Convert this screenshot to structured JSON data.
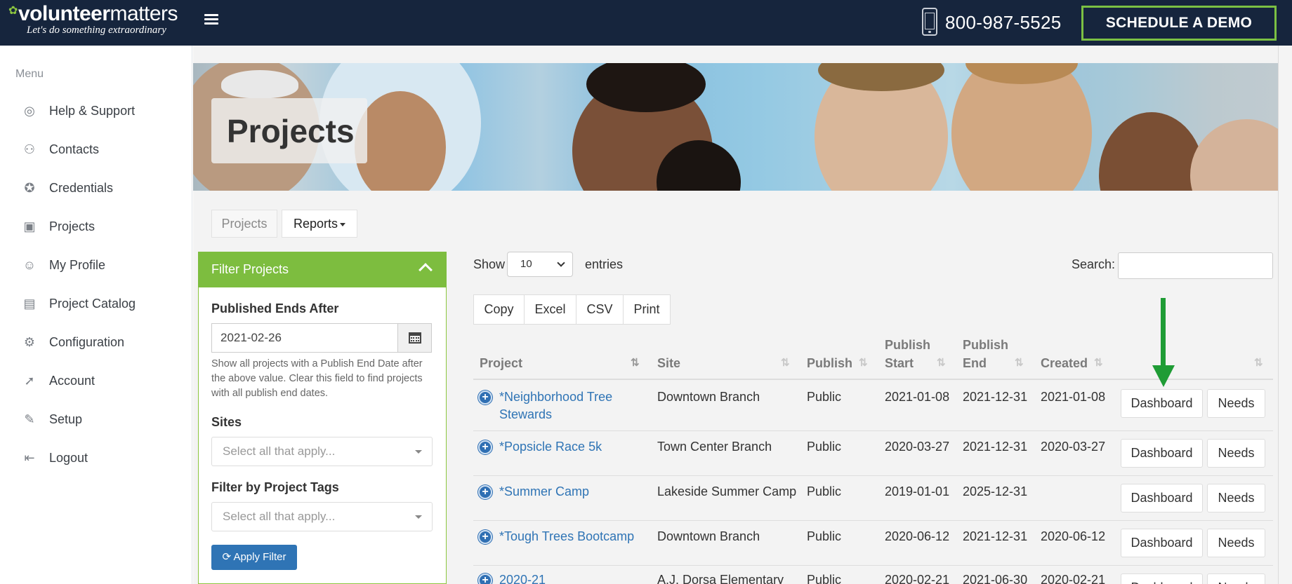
{
  "header": {
    "logo_bold": "volunteer",
    "logo_light": "matters",
    "tagline": "Let's do something extraordinary",
    "phone": "800-987-5525",
    "demo_button": "SCHEDULE A DEMO"
  },
  "sidebar": {
    "title": "Menu",
    "items": [
      {
        "label": "Help & Support",
        "icon": "help-icon"
      },
      {
        "label": "Contacts",
        "icon": "contacts-icon"
      },
      {
        "label": "Credentials",
        "icon": "credentials-icon"
      },
      {
        "label": "Projects",
        "icon": "projects-icon"
      },
      {
        "label": "My Profile",
        "icon": "profile-icon"
      },
      {
        "label": "Project Catalog",
        "icon": "catalog-icon"
      },
      {
        "label": "Configuration",
        "icon": "gear-icon"
      },
      {
        "label": "Account",
        "icon": "rocket-icon"
      },
      {
        "label": "Setup",
        "icon": "wrench-icon"
      },
      {
        "label": "Logout",
        "icon": "logout-icon"
      }
    ]
  },
  "banner": {
    "title": "Projects"
  },
  "tabs": {
    "projects": "Projects",
    "reports": "Reports"
  },
  "filter": {
    "header": "Filter Projects",
    "published_label": "Published Ends After",
    "published_value": "2021-02-26",
    "help_text": "Show all projects with a Publish End Date after the above value. Clear this field to find projects with all publish end dates.",
    "sites_label": "Sites",
    "sites_placeholder": "Select all that apply...",
    "tags_label": "Filter by Project Tags",
    "tags_placeholder": "Select all that apply...",
    "apply_button": "Apply Filter"
  },
  "table_controls": {
    "show": "Show",
    "page_size": "10",
    "entries": "entries",
    "search": "Search:",
    "export_buttons": [
      "Copy",
      "Excel",
      "CSV",
      "Print"
    ]
  },
  "table": {
    "headers": {
      "project": "Project",
      "site": "Site",
      "publish": "Publish",
      "publish_start_1": "Publish",
      "publish_start_2": "Start",
      "publish_end_1": "Publish",
      "publish_end_2": "End",
      "created": "Created"
    },
    "dashboard_label": "Dashboard",
    "needs_label": "Needs",
    "rows": [
      {
        "project_1": "*Neighborhood Tree",
        "project_2": "Stewards",
        "site": "Downtown Branch",
        "publish": "Public",
        "start": "2021-01-08",
        "end": "2021-12-31",
        "created": "2021-01-08"
      },
      {
        "project_1": "*Popsicle Race 5k",
        "project_2": "",
        "site": "Town Center Branch",
        "publish": "Public",
        "start": "2020-03-27",
        "end": "2021-12-31",
        "created": "2020-03-27"
      },
      {
        "project_1": "*Summer Camp",
        "project_2": "",
        "site": "Lakeside Summer Camp",
        "publish": "Public",
        "start": "2019-01-01",
        "end": "2025-12-31",
        "created": ""
      },
      {
        "project_1": "*Tough Trees Bootcamp",
        "project_2": "",
        "site": "Downtown Branch",
        "publish": "Public",
        "start": "2020-06-12",
        "end": "2021-12-31",
        "created": "2020-06-12"
      },
      {
        "project_1": "2020-21",
        "project_2": "",
        "site": "A.J. Dorsa Elementary",
        "publish": "Public",
        "start": "2020-02-21",
        "end": "2021-06-30",
        "created": "2020-02-21"
      }
    ]
  },
  "colors": {
    "topbar": "#16253d",
    "accent_green": "#7dbd3f",
    "link_blue": "#2f74b5",
    "arrow_green": "#1f9c35"
  }
}
